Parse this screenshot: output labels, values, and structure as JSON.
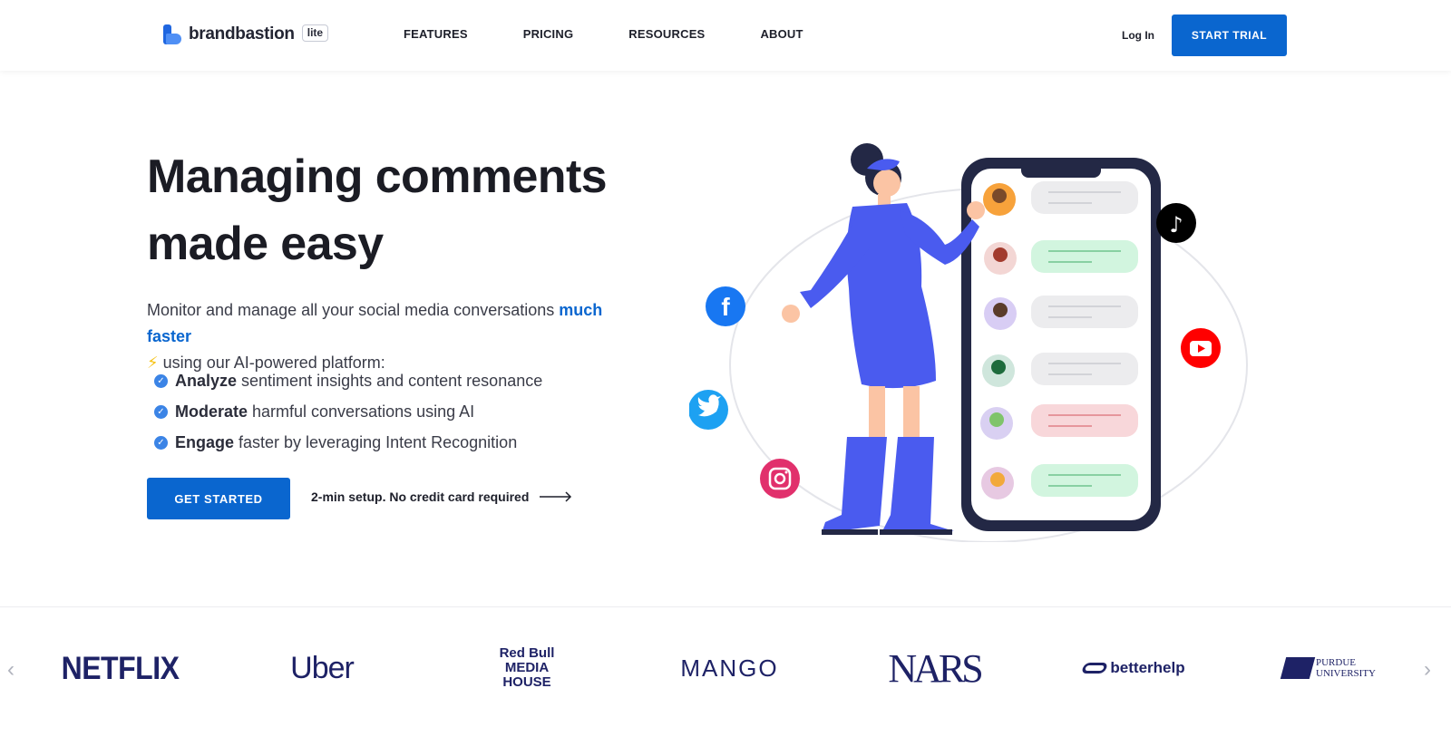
{
  "header": {
    "logo_text": "brandbastion",
    "logo_badge": "lite",
    "nav": [
      "FEATURES",
      "PRICING",
      "RESOURCES",
      "ABOUT"
    ],
    "login": "Log In",
    "trial_button": "START TRIAL"
  },
  "hero": {
    "title_line1": "Managing comments",
    "title_line2": "made easy",
    "desc_before": "Monitor and manage all your social media conversations",
    "desc_accent": "much faster",
    "desc_emoji": "⚡",
    "desc_after": "using our AI-powered platform:",
    "checks": [
      {
        "bold": "Analyze",
        "text": "sentiment insights and content resonance"
      },
      {
        "bold": "Moderate",
        "text": "harmful conversations using AI"
      },
      {
        "bold": "Engage",
        "text": "faster by leveraging Intent Recognition"
      }
    ],
    "cta_button": "GET STARTED",
    "cta_note": "2-min setup. No credit card required"
  },
  "illustration": {
    "social_icons": [
      "facebook-icon",
      "twitter-icon",
      "instagram-icon",
      "tiktok-icon",
      "youtube-icon"
    ],
    "comment_colors": [
      "#ececee",
      "#d2f5df",
      "#ececee",
      "#ececee",
      "#f8d7da",
      "#d2f5df"
    ],
    "brand_colors": {
      "primary": "#0a66cf",
      "figure": "#4a5bef",
      "phone": "#232845"
    }
  },
  "logos": {
    "brands": [
      "NETFLIX",
      "Uber",
      "Red Bull MEDIA HOUSE",
      "MANGO",
      "NARS",
      "betterhelp",
      "PURDUE UNIVERSITY"
    ]
  }
}
